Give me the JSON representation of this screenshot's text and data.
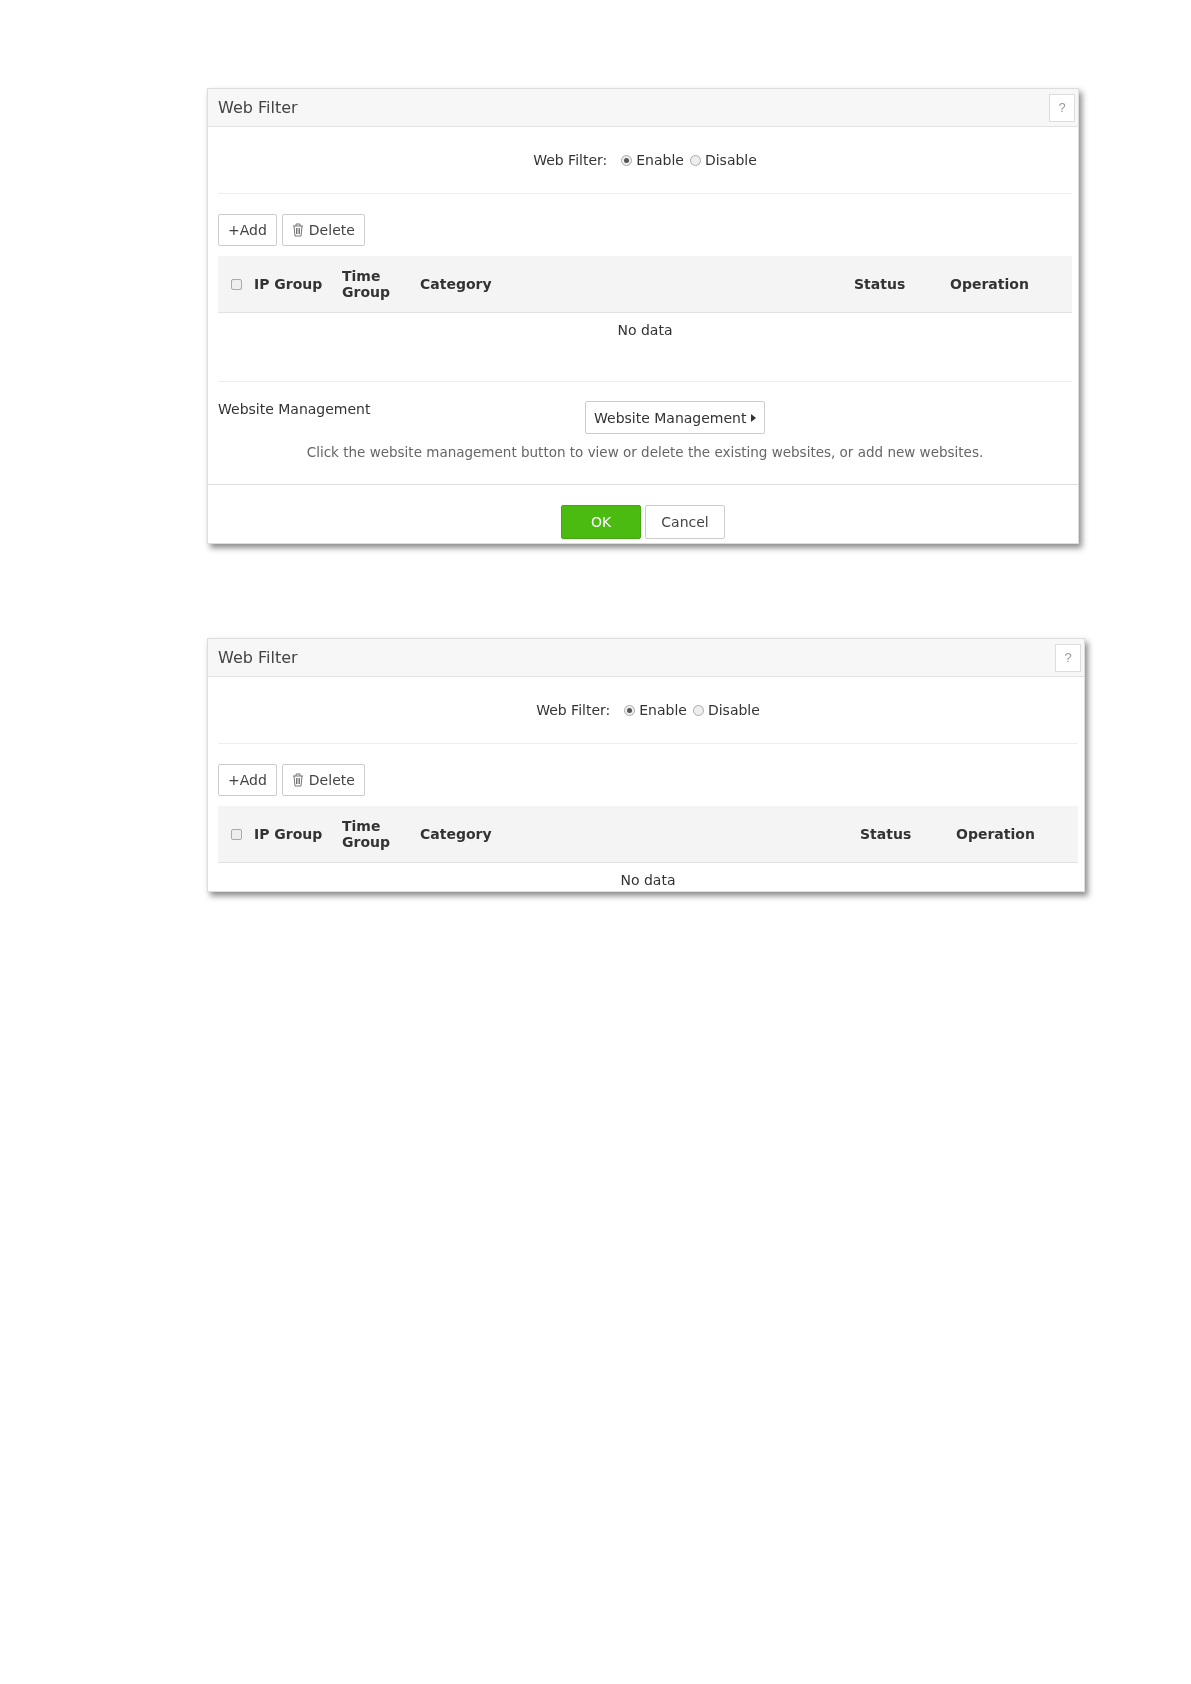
{
  "dialogs": [
    {
      "title": "Web Filter",
      "help": "?",
      "web_filter": {
        "label": "Web Filter:",
        "options": [
          {
            "label": "Enable",
            "selected": true
          },
          {
            "label": "Disable",
            "selected": false
          }
        ]
      },
      "toolbar": [
        {
          "kind": "add",
          "label": "+Add"
        },
        {
          "kind": "delete",
          "label": "Delete"
        }
      ],
      "table": {
        "select_all": {
          "checked": false
        },
        "columns": [
          "IP Group",
          "Time Group",
          "Category",
          "Status",
          "Operation"
        ],
        "empty_text": "No data"
      },
      "website_management": {
        "label": "Website Management",
        "button": "Website Management",
        "hint": "Click the website management button to view or delete the existing websites, or add new websites."
      },
      "footer": [
        {
          "kind": "primary",
          "label": "OK"
        },
        {
          "kind": "secondary",
          "label": "Cancel"
        }
      ]
    },
    {
      "title": "Web Filter",
      "help": "?",
      "web_filter": {
        "label": "Web Filter:",
        "options": [
          {
            "label": "Enable",
            "selected": true
          },
          {
            "label": "Disable",
            "selected": false
          }
        ]
      },
      "toolbar": [
        {
          "kind": "add",
          "label": "+Add"
        },
        {
          "kind": "delete",
          "label": "Delete"
        }
      ],
      "table": {
        "select_all": {
          "checked": false
        },
        "columns": [
          "IP Group",
          "Time Group",
          "Category",
          "Status",
          "Operation"
        ],
        "empty_text": "No data"
      }
    }
  ]
}
